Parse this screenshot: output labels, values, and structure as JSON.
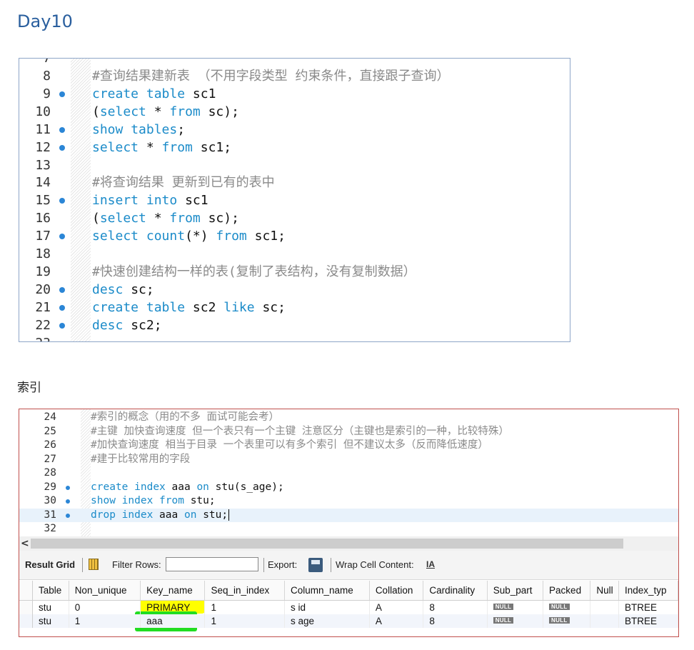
{
  "page": {
    "title": "Day10",
    "section_title": "索引"
  },
  "editor1": {
    "top_partial_line": "7",
    "bottom_partial_line": "23",
    "lines": [
      {
        "num": "8",
        "dot": false,
        "text": "#查询结果建新表 （不用字段类型 约束条件，直接跟子查询）"
      },
      {
        "num": "9",
        "dot": true,
        "text": "create table sc1"
      },
      {
        "num": "10",
        "dot": false,
        "text": "(select * from sc);"
      },
      {
        "num": "11",
        "dot": true,
        "text": "show tables;"
      },
      {
        "num": "12",
        "dot": true,
        "text": "select * from sc1;"
      },
      {
        "num": "13",
        "dot": false,
        "text": ""
      },
      {
        "num": "14",
        "dot": false,
        "text": "#将查询结果 更新到已有的表中"
      },
      {
        "num": "15",
        "dot": true,
        "text": "insert into sc1"
      },
      {
        "num": "16",
        "dot": false,
        "text": "(select * from sc);"
      },
      {
        "num": "17",
        "dot": true,
        "text": "select count(*) from sc1;"
      },
      {
        "num": "18",
        "dot": false,
        "text": ""
      },
      {
        "num": "19",
        "dot": false,
        "text": "#快速创建结构一样的表(复制了表结构，没有复制数据）"
      },
      {
        "num": "20",
        "dot": true,
        "text": "desc sc;"
      },
      {
        "num": "21",
        "dot": true,
        "text": "create table sc2 like sc;"
      },
      {
        "num": "22",
        "dot": true,
        "text": "desc sc2;"
      }
    ]
  },
  "editor2": {
    "lines": [
      {
        "num": "24",
        "dot": false,
        "text": "#索引的概念（用的不多 面试可能会考）"
      },
      {
        "num": "25",
        "dot": false,
        "text": "#主键 加快查询速度 但一个表只有一个主键 注意区分（主键也是索引的一种，比较特殊）"
      },
      {
        "num": "26",
        "dot": false,
        "text": "#加快查询速度 相当于目录 一个表里可以有多个索引 但不建议太多（反而降低速度）"
      },
      {
        "num": "27",
        "dot": false,
        "text": "#建于比较常用的字段"
      },
      {
        "num": "28",
        "dot": false,
        "text": ""
      },
      {
        "num": "29",
        "dot": true,
        "text": "create index aaa on stu(s_age);"
      },
      {
        "num": "30",
        "dot": true,
        "text": "show index from stu;"
      },
      {
        "num": "31",
        "dot": true,
        "text": "drop index aaa on stu;"
      },
      {
        "num": "32",
        "dot": false,
        "text": ""
      }
    ]
  },
  "toolbar": {
    "result_grid": "Result Grid",
    "filter_rows": "Filter Rows:",
    "export": "Export:",
    "wrap_cell": "Wrap Cell Content:",
    "wrap_icon_text": "IA",
    "scroll_left_glyph": "<"
  },
  "result": {
    "columns": [
      "Table",
      "Non_unique",
      "Key_name",
      "Seq_in_index",
      "Column_name",
      "Collation",
      "Cardinality",
      "Sub_part",
      "Packed",
      "Null",
      "Index_typ"
    ],
    "rows": [
      [
        "stu",
        "0",
        "PRIMARY",
        "1",
        "s id",
        "A",
        "8",
        "NULL",
        "NULL",
        "",
        "BTREE"
      ],
      [
        "stu",
        "1",
        "aaa",
        "1",
        "s age",
        "A",
        "8",
        "NULL",
        "NULL",
        "",
        "BTREE"
      ]
    ],
    "highlight_colors": {
      "primary": "#ffff00",
      "aaa": "#22dd22"
    }
  }
}
